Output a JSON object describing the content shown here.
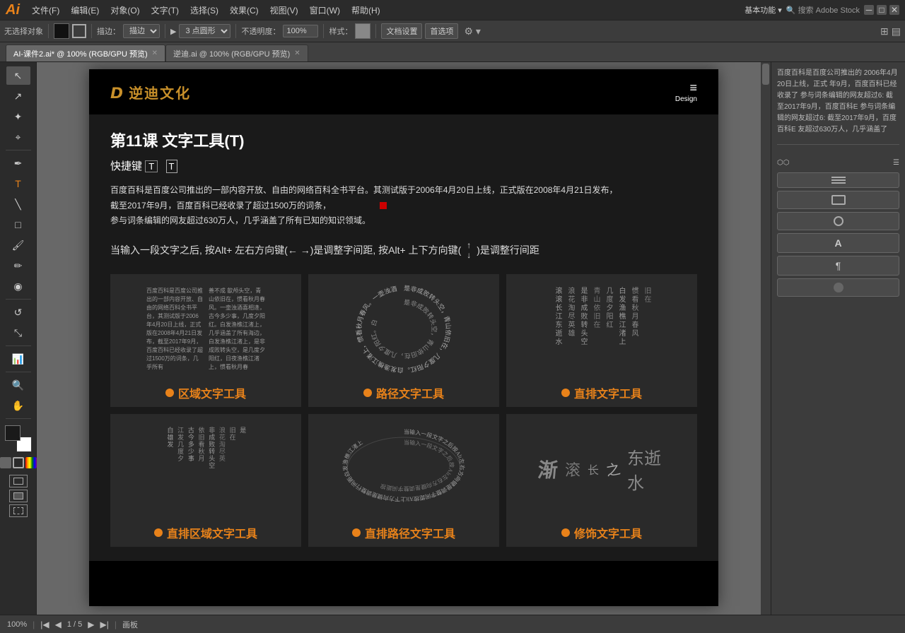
{
  "app": {
    "name": "Ai",
    "icon_color": "#e8821a"
  },
  "menu": {
    "items": [
      "文件(F)",
      "编辑(E)",
      "对象(O)",
      "文字(T)",
      "选择(S)",
      "效果(C)",
      "视图(V)",
      "窗口(W)",
      "帮助(H)"
    ]
  },
  "toolbar": {
    "no_selection": "无选择对象",
    "stroke_label": "描边：",
    "point_shape": "3 点圆形",
    "opacity_label": "不透明度：",
    "opacity_value": "100%",
    "style_label": "样式：",
    "doc_settings": "文档设置",
    "preferences": "首选项"
  },
  "tabs": [
    {
      "label": "AI-课件2.ai* @ 100% (RGB/GPU 预览)",
      "active": true
    },
    {
      "label": "逆迪.ai @ 100% (RGB/GPU 预览)",
      "active": false
    }
  ],
  "right_panel": {
    "text": "百度百科是百度公司推出的 2006年4月20日上线，正式 年9月，百度百科已经收录了 参与词条编辑的网友超过6: 截至2017年9月，百度百科E 参与词条编辑的网友超过6: 截至2017年9月，百度百科E 友超过630万人，几乎涵盖了"
  },
  "document": {
    "logo_icon": "ᴅ",
    "logo_text": "逆迪文化",
    "menu_icon": "≡",
    "menu_label": "Design",
    "lesson_title": "第11课   文字工具(T)",
    "shortcut_label": "快捷键",
    "shortcut_key": "T",
    "desc_text": "百度百科是百度公司推出的一部内容开放、自由的网络百科全书平台。其测试版于2006年4月20日上线，正式版在2008年4月21日发布，\n截至2017年9月，百度百科已经收录了超过1500万的词条，\n参与词条编辑的网友超过630万人，几乎涵盖了所有已知的知识领域。",
    "instruction": "当输入一段文字之后, 按Alt+ 左右方向键(← →)是调整字间距, 按Alt+ 上下方向键(",
    "instruction2": ")是调整行间距",
    "tools": [
      {
        "name": "区域文字工具",
        "dot_color": "#e8821a",
        "sample_text": "百度百科是百度公司推出的一部内容开放、自由的网络百科全书平台。其测试版于2006年4月20日上线，正式版在2008年4月21日发布，截至2017年9月，百度百科已经收录了超过1500万的词条，几乎涵盖了所有已知的知识领域。"
      },
      {
        "name": "路径文字工具",
        "dot_color": "#e8821a",
        "sample_text": "是非成败转头空，青山依旧在，几度夕阳红。白发渔樵江渚上，惯看秋月春风。"
      },
      {
        "name": "直排文字工具",
        "dot_color": "#e8821a",
        "sample_text": "滚滚长江东逝水，浪花淘尽英雄。是非成败转头空，青山依旧在，几度夕阳红。白发渔樵江渚上，惯看秋月春风。一壶浊酒喜相逢，古今多少事，都付笑谈中。"
      }
    ],
    "tools2": [
      {
        "name": "直排区域文字工具",
        "dot_color": "#e8821a",
        "sample_text": "非成败转头空，青山依旧在，几度夕阳红。白发渔樵江渚上，惯看秋月春风。"
      },
      {
        "name": "直排路径文字工具",
        "dot_color": "#e8821a"
      },
      {
        "name": "修饰文字工具",
        "dot_color": "#e8821a"
      }
    ]
  },
  "status_bar": {
    "zoom": "100%",
    "page_info": "1 / 5",
    "nav_label": "画板"
  },
  "colors": {
    "orange": "#e8821a",
    "dark_bg": "#1a1a1a",
    "panel_bg": "#3c3c3c",
    "canvas_bg": "#686868"
  }
}
